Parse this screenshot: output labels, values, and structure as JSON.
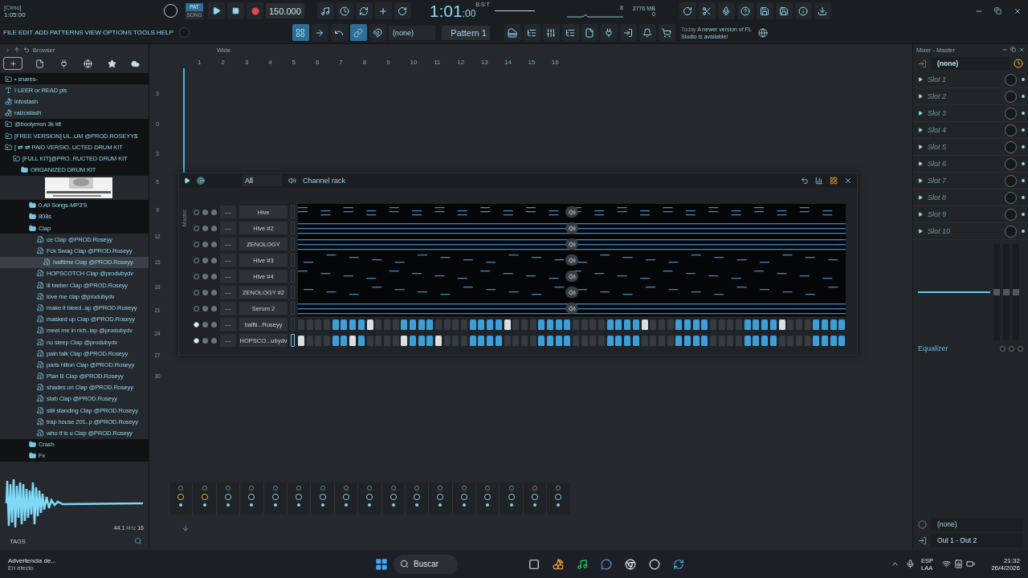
{
  "app": {
    "song_name": "[Cimo]",
    "song_time": "1:05:00"
  },
  "menu": [
    "FILE",
    "EDIT",
    "ADD",
    "PATTERNS",
    "VIEW",
    "OPTIONS",
    "TOOLS",
    "HELP"
  ],
  "transport": {
    "pat_label": "PAT",
    "song_label": "SONG",
    "pattern_mode": true,
    "tempo": "150.000",
    "time_main": "1:01",
    "time_sub": ":00",
    "time_unit": "B:S:T",
    "cpu_value": "8",
    "memory": "2776 MB",
    "polyphony": "0"
  },
  "toolbar": {
    "preset": "(none)",
    "pattern": "Pattern 1",
    "news_date": "Today",
    "news_text": "A newer version of FL Studio is available!"
  },
  "browser": {
    "title": "Browser",
    "tree": [
      {
        "label": "• snares-",
        "kind": "link_folder",
        "selected": false
      },
      {
        "label": "! LEER or READ pls",
        "kind": "text",
        "selected": false
      },
      {
        "label": "infostash",
        "kind": "plugin",
        "selected": false
      },
      {
        "label": "raizostash",
        "kind": "plugin",
        "selected": false
      },
      {
        "label": "@boolymon 3k kit",
        "kind": "link_folder",
        "selected": false
      },
      {
        "label": "[FREE VERSION] UL..UM @PROD.ROSEYY$",
        "kind": "link_folder",
        "selected": false
      },
      {
        "label": "[ ⇄ ⇄ PAID VERSIO..UCTED DRUM KIT",
        "kind": "link_folder",
        "selected": false,
        "children": [
          {
            "label": "[FULL KIT]@PRO..RUCTED DRUM KIT",
            "kind": "link_folder",
            "selected": false,
            "children": [
              {
                "label": "ORGANIZED DRUM KIT",
                "kind": "folder",
                "selected": false,
                "children": [
                  {
                    "kind": "picture",
                    "selected": false
                  },
                  {
                    "label": "0.All Songs-MP3'S",
                    "kind": "folder",
                    "selected": false
                  },
                  {
                    "label": "808s",
                    "kind": "folder",
                    "selected": false
                  },
                  {
                    "label": "Clap",
                    "kind": "folder",
                    "selected": false,
                    "children": [
                      {
                        "label": "ce Clap @PROD.Roseyy",
                        "kind": "audio",
                        "selected": false
                      },
                      {
                        "label": "Fck Swag Clap @PROD.Roseyy",
                        "kind": "audio",
                        "selected": false
                      },
                      {
                        "label": "halftime Clap @PROD.Roseyy",
                        "kind": "audio",
                        "selected": true
                      },
                      {
                        "label": "HOPSCOTCH Clap @produbydv",
                        "kind": "audio",
                        "selected": false
                      },
                      {
                        "label": "lil bieber Clap @PROD.Roseyy",
                        "kind": "audio",
                        "selected": false
                      },
                      {
                        "label": "love me clap @produbydv",
                        "kind": "audio",
                        "selected": false
                      },
                      {
                        "label": "make it bleed..ap @PROD.Roseyy",
                        "kind": "audio",
                        "selected": false
                      },
                      {
                        "label": "masked up Clap @PROD.Roseyy",
                        "kind": "audio",
                        "selected": false
                      },
                      {
                        "label": "meet me in rich..lap @produbydv",
                        "kind": "audio",
                        "selected": false
                      },
                      {
                        "label": "no sleep Clap @produbydv",
                        "kind": "audio",
                        "selected": false
                      },
                      {
                        "label": "pain talk Clap @PROD.Roseyy",
                        "kind": "audio",
                        "selected": false
                      },
                      {
                        "label": "paris hilton Clap @PROD.Roseyy",
                        "kind": "audio",
                        "selected": false
                      },
                      {
                        "label": "Plan B Clap @PROD.Roseyy",
                        "kind": "audio",
                        "selected": false
                      },
                      {
                        "label": "shades on Clap @PROD.Roseyy",
                        "kind": "audio",
                        "selected": false
                      },
                      {
                        "label": "stab Clap @PROD.Roseyy",
                        "kind": "audio",
                        "selected": false
                      },
                      {
                        "label": "still standing Clap @PROD.Roseyy",
                        "kind": "audio",
                        "selected": false
                      },
                      {
                        "label": "trap house 201..p @PROD.Roseyy",
                        "kind": "audio",
                        "selected": false
                      },
                      {
                        "label": "who tf is u Clap @PROD.Roseyy",
                        "kind": "audio",
                        "selected": false
                      }
                    ]
                  },
                  {
                    "label": "Crash",
                    "kind": "folder",
                    "selected": false
                  },
                  {
                    "label": "Fx",
                    "kind": "folder",
                    "selected": false
                  }
                ]
              }
            ]
          }
        ]
      }
    ],
    "sample_rate": "44.1",
    "sample_unit": "kHz",
    "sample_bits": "16",
    "tags_label": "TAGS"
  },
  "playlist": {
    "snap": "Wide",
    "bars": [
      "1",
      "2",
      "3",
      "4",
      "5",
      "6",
      "7",
      "8",
      "9",
      "10",
      "11",
      "12",
      "13",
      "14",
      "15",
      "16"
    ],
    "scale": [
      "3",
      "0",
      "3",
      "6",
      "9",
      "12",
      "15",
      "18",
      "21",
      "24",
      "27",
      "30"
    ]
  },
  "channel_rack": {
    "title": "Channel rack",
    "filter": "All",
    "side_label": "Master",
    "channels": [
      {
        "name": "Hive",
        "mixer_track": "—",
        "kind": "notes",
        "lit": false,
        "selected": false
      },
      {
        "name": "Hive #2",
        "mixer_track": "—",
        "kind": "notes",
        "lit": false,
        "selected": false
      },
      {
        "name": "ZENOLOGY",
        "mixer_track": "—",
        "kind": "notes",
        "lit": false,
        "selected": false
      },
      {
        "name": "Hive #3",
        "mixer_track": "—",
        "kind": "notes",
        "lit": false,
        "selected": false
      },
      {
        "name": "Hive #4",
        "mixer_track": "—",
        "kind": "notes",
        "lit": false,
        "selected": false
      },
      {
        "name": "ZENOLOGY #2",
        "mixer_track": "—",
        "kind": "notes",
        "lit": false,
        "selected": false
      },
      {
        "name": "Serum 2",
        "mixer_track": "—",
        "kind": "notes",
        "lit": false,
        "selected": false
      },
      {
        "name": "halfti...Roseyy",
        "mixer_track": "—",
        "kind": "steps",
        "lit": true,
        "selected": false,
        "steps_on": [
          false,
          false,
          false,
          false,
          true,
          true,
          true,
          true,
          false,
          false,
          false,
          false,
          true,
          true,
          true,
          true,
          false,
          false,
          false,
          false,
          true,
          true,
          true,
          true,
          false,
          false,
          false,
          false,
          true,
          true,
          true,
          true,
          false,
          false,
          false,
          false,
          true,
          true,
          true,
          true,
          false,
          false,
          false,
          false,
          true,
          true,
          true,
          true,
          false,
          false,
          false,
          false,
          true,
          true,
          true,
          true,
          false,
          false,
          false,
          false,
          true,
          true,
          true,
          true
        ],
        "steps_lit": [
          false,
          false,
          false,
          false,
          false,
          false,
          false,
          false,
          true,
          false,
          false,
          false,
          false,
          false,
          false,
          false,
          false,
          false,
          false,
          false,
          false,
          false,
          false,
          false,
          true,
          false,
          false,
          false,
          false,
          false,
          false,
          false,
          false,
          false,
          false,
          false,
          false,
          false,
          false,
          false,
          true,
          false,
          false,
          false,
          false,
          false,
          false,
          false,
          false,
          false,
          false,
          false,
          false,
          false,
          false,
          false,
          true,
          false,
          false,
          false,
          false,
          false,
          false,
          false
        ]
      },
      {
        "name": "HOPSCO...ubydv",
        "mixer_track": "—",
        "kind": "steps",
        "lit": true,
        "selected": true,
        "steps_on": [
          false,
          false,
          false,
          false,
          true,
          true,
          false,
          true,
          false,
          false,
          false,
          false,
          false,
          true,
          true,
          true,
          false,
          false,
          false,
          false,
          true,
          true,
          true,
          true,
          false,
          false,
          false,
          false,
          true,
          true,
          true,
          true,
          false,
          false,
          false,
          false,
          true,
          true,
          true,
          true,
          false,
          false,
          false,
          false,
          true,
          true,
          true,
          true,
          false,
          false,
          false,
          false,
          true,
          true,
          true,
          true,
          false,
          false,
          false,
          false,
          true,
          true,
          true,
          true
        ],
        "steps_lit": [
          true,
          false,
          false,
          false,
          false,
          false,
          true,
          false,
          false,
          false,
          false,
          false,
          true,
          false,
          false,
          false,
          true,
          false,
          false,
          false,
          false,
          false,
          false,
          false,
          false,
          false,
          false,
          false,
          false,
          false,
          false,
          false,
          false,
          false,
          false,
          false,
          false,
          false,
          false,
          false,
          false,
          false,
          false,
          false,
          false,
          false,
          false,
          false,
          false,
          false,
          false,
          false,
          false,
          false,
          false,
          false,
          false,
          false,
          false,
          false,
          false,
          false,
          false,
          false
        ]
      }
    ]
  },
  "mixer_strips": [
    {
      "selected": true
    },
    {
      "selected": true
    },
    {
      "selected": false
    },
    {
      "selected": false
    },
    {
      "selected": false
    },
    {
      "selected": false
    },
    {
      "selected": false
    },
    {
      "selected": false
    },
    {
      "selected": false
    },
    {
      "selected": false
    },
    {
      "selected": false
    },
    {
      "selected": false
    },
    {
      "selected": false
    },
    {
      "selected": false
    },
    {
      "selected": false
    },
    {
      "selected": false
    },
    {
      "selected": false
    }
  ],
  "mixer": {
    "title": "Mixer - Master",
    "input": "(none)",
    "slots": [
      "Slot 1",
      "Slot 2",
      "Slot 3",
      "Slot 4",
      "Slot 5",
      "Slot 6",
      "Slot 7",
      "Slot 8",
      "Slot 9",
      "Slot 10"
    ],
    "eq_label": "Equalizer",
    "output_preset": "(none)",
    "output": "Out 1 - Out 2"
  },
  "taskbar": {
    "notice_title": "Advertencia de...",
    "notice_sub": "En efecto",
    "search": "Buscar",
    "lang": "ESP",
    "layout": "LAA",
    "time": "21:32",
    "date": "26/4/2026"
  }
}
